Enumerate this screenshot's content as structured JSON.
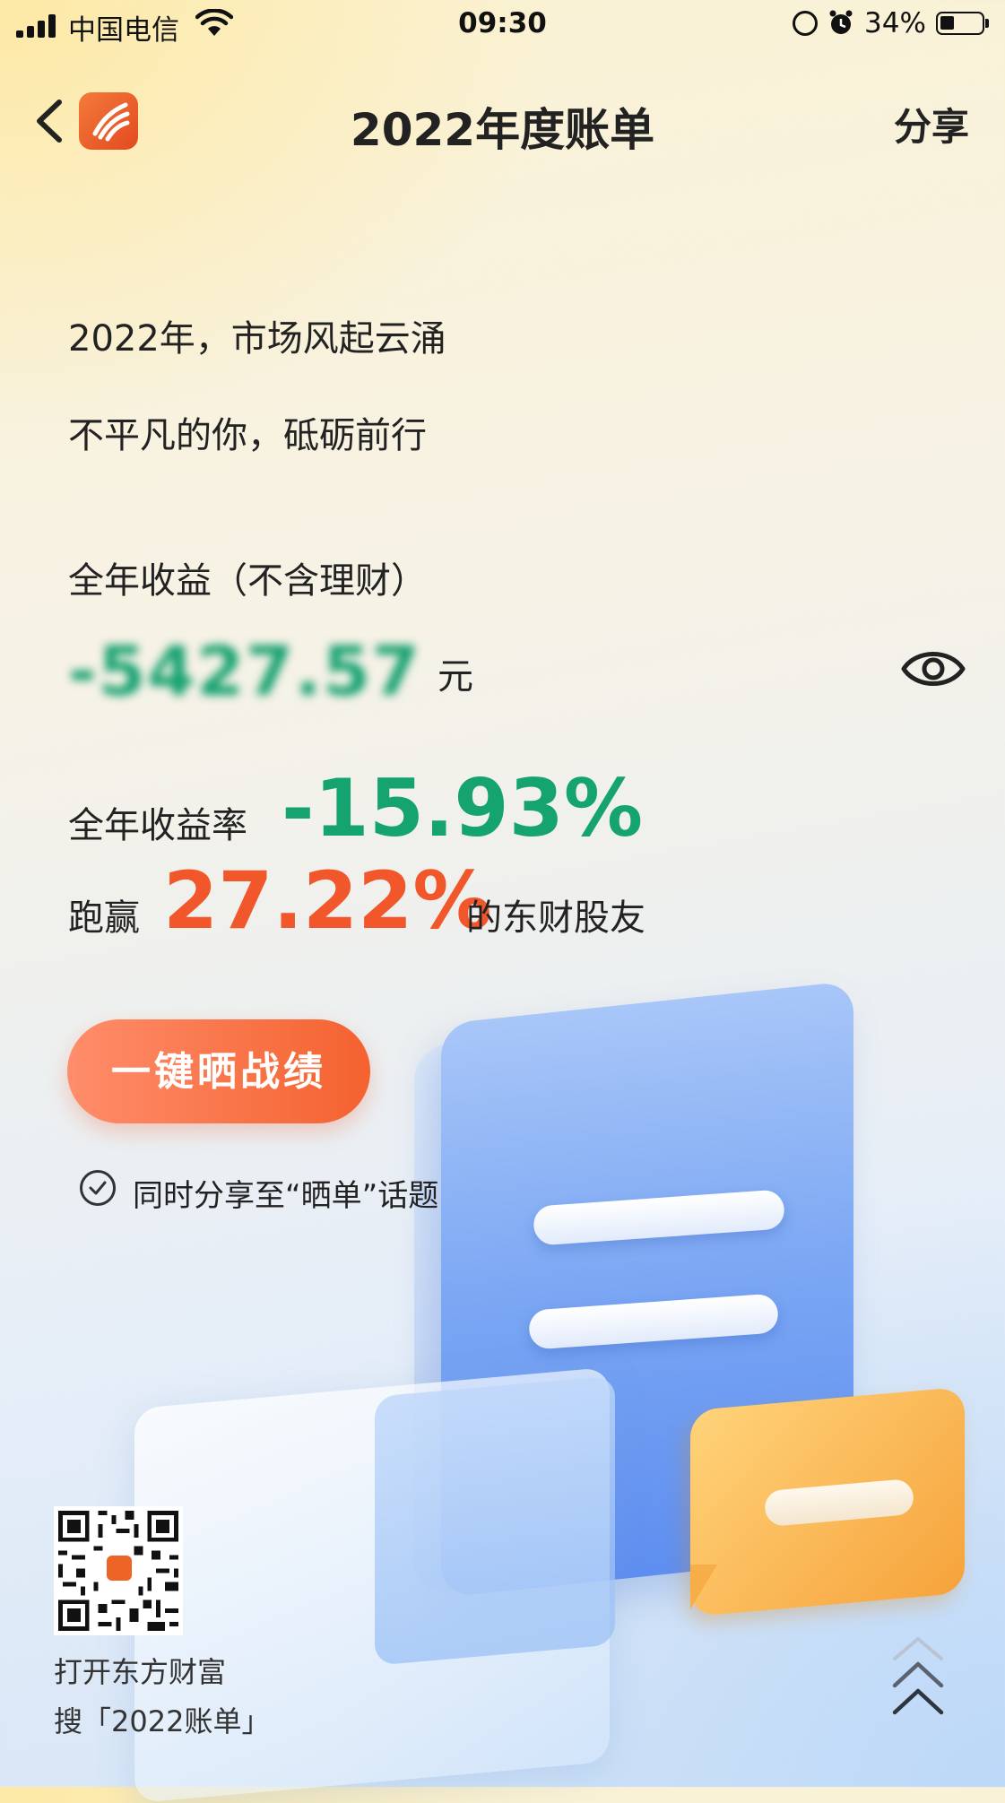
{
  "status_bar": {
    "carrier": "中国电信",
    "time": "09:30",
    "battery": "34%",
    "battery_level": 0.34,
    "icons": [
      "signal-icon",
      "wifi-icon",
      "rotation-lock-icon",
      "alarm-icon",
      "battery-icon"
    ]
  },
  "nav": {
    "title": "2022年度账单",
    "share_label": "分享",
    "icons": [
      "back-chevron-icon",
      "app-logo-icon"
    ]
  },
  "intro": {
    "line1": "2022年，市场风起云涌",
    "line2": "不平凡的你，砥砺前行"
  },
  "profit": {
    "label": "全年收益（不含理财）",
    "value_obscured": "-5427.57",
    "unit": "元",
    "toggle_icon": "eye-icon"
  },
  "rate": {
    "label": "全年收益率",
    "value": "-15.93%"
  },
  "beat": {
    "prefix": "跑赢",
    "value": "27.22%",
    "suffix": "的东财股友"
  },
  "cta": {
    "button_label": "一键晒战绩",
    "checkbox_label": "同时分享至“晒单”话题"
  },
  "footer": {
    "line1": "打开东方财富",
    "line2": "搜「2022账单」"
  },
  "colors": {
    "green": "#15a36f",
    "orange": "#f2572b",
    "button": "#f4622f"
  }
}
